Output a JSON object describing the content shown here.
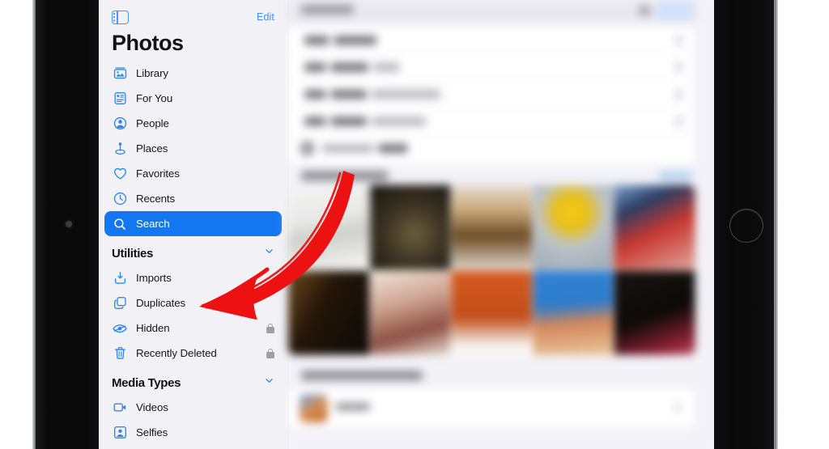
{
  "device": {
    "kind": "tablet",
    "camera": "front-camera",
    "home_button": "home-button"
  },
  "sidebar": {
    "toggle_icon": "sidebar-toggle-icon",
    "edit_label": "Edit",
    "title": "Photos",
    "items": [
      {
        "label": "Library",
        "icon": "library-icon",
        "selected": false,
        "locked": false
      },
      {
        "label": "For You",
        "icon": "for-you-icon",
        "selected": false,
        "locked": false
      },
      {
        "label": "People",
        "icon": "people-icon",
        "selected": false,
        "locked": false
      },
      {
        "label": "Places",
        "icon": "places-pin-icon",
        "selected": false,
        "locked": false
      },
      {
        "label": "Favorites",
        "icon": "heart-icon",
        "selected": false,
        "locked": false
      },
      {
        "label": "Recents",
        "icon": "clock-icon",
        "selected": false,
        "locked": false
      },
      {
        "label": "Search",
        "icon": "search-icon",
        "selected": true,
        "locked": false
      }
    ],
    "groups": [
      {
        "title": "Utilities",
        "chevron": "chevron-down-icon",
        "items": [
          {
            "label": "Imports",
            "icon": "import-icon",
            "locked": false
          },
          {
            "label": "Duplicates",
            "icon": "duplicates-icon",
            "locked": false
          },
          {
            "label": "Hidden",
            "icon": "eye-slash-icon",
            "locked": true
          },
          {
            "label": "Recently Deleted",
            "icon": "trash-icon",
            "locked": true
          }
        ]
      },
      {
        "title": "Media Types",
        "chevron": "chevron-down-icon",
        "items": [
          {
            "label": "Videos",
            "icon": "video-camera-icon",
            "locked": false
          },
          {
            "label": "Selfies",
            "icon": "selfie-icon",
            "locked": false
          }
        ]
      }
    ]
  },
  "content": {
    "description": "blurred-photos-search-results",
    "search_field": {
      "placeholder_blurred": true,
      "clear_icon": "clear-icon",
      "cancel_button": "cancel-button"
    },
    "result_rows": 5,
    "photo_grid": {
      "columns": 5,
      "rows": 2,
      "tiles": 10
    },
    "suggestion_rows": 1
  },
  "annotation": {
    "type": "curved-arrow",
    "color": "#ee1111",
    "points_to": "Duplicates",
    "direction": "down-left"
  },
  "colors": {
    "accent": "#1277f1",
    "link": "#3e8ef7",
    "sidebar_bg": "#f2f2f6",
    "content_bg": "#f2f2f7",
    "text": "#17171a",
    "lock": "#9a9aa0",
    "arrow": "#ee1111"
  }
}
